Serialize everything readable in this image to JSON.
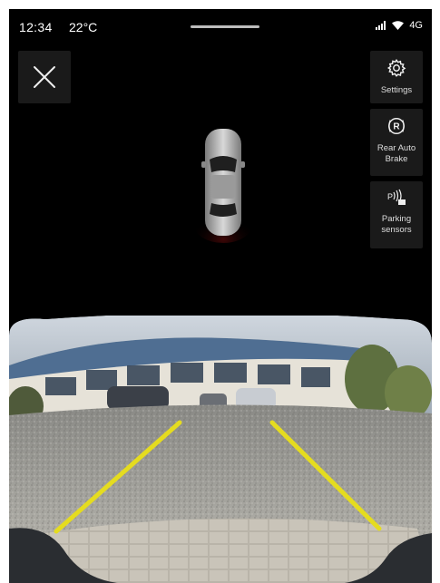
{
  "status_bar": {
    "time": "12:34",
    "temperature": "22°C",
    "network": "4G"
  },
  "top_left": {
    "close_icon": "close-icon"
  },
  "side_controls": [
    {
      "label": "Settings",
      "icon": "gear-icon"
    },
    {
      "label": "Rear Auto Brake",
      "icon": "r-circle-icon"
    },
    {
      "label": "Parking sensors",
      "icon": "parking-sensors-icon"
    }
  ],
  "colors": {
    "background": "#000000",
    "button_bg": "#1a1a1a",
    "guide_line": "#e5dc1f"
  }
}
